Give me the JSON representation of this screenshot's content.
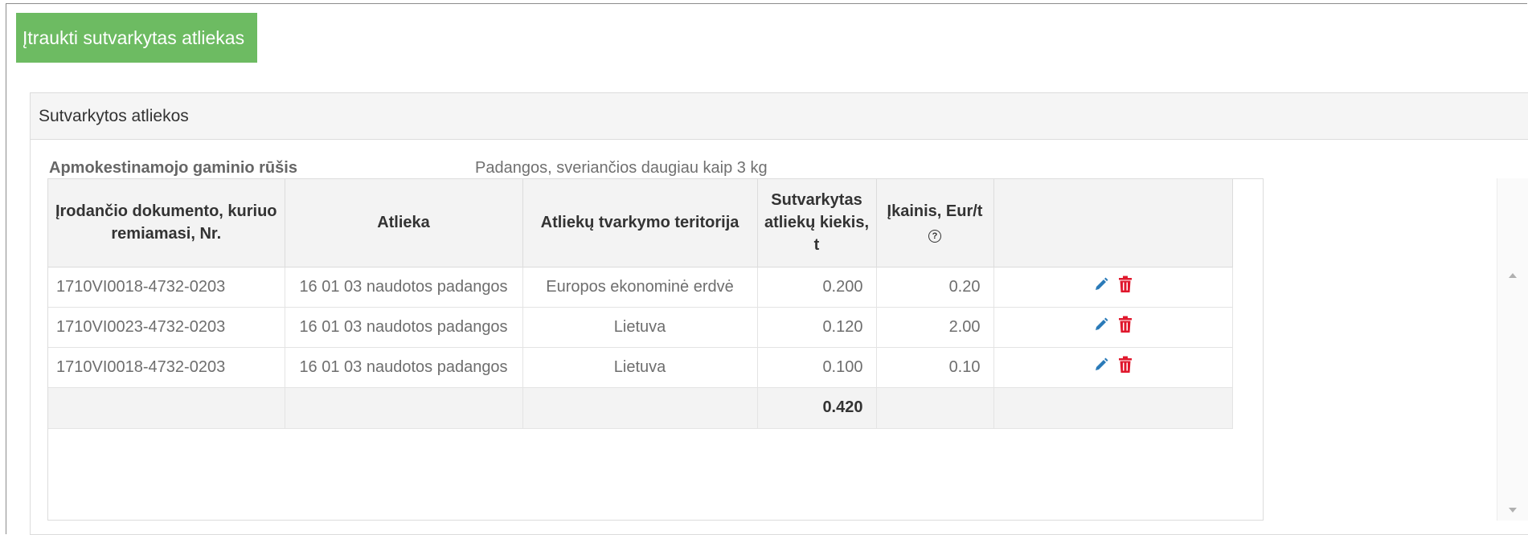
{
  "button": {
    "label": "Įtraukti sutvarkytas atliekas",
    "color": "#6dbb62"
  },
  "panel": {
    "title": "Sutvarkytos atliekos",
    "product_type_label": "Apmokestinamojo gaminio rūšis",
    "product_type_value": "Padangos, sveriančios daugiau kaip 3 kg"
  },
  "table": {
    "headers": {
      "doc_no": "Įrodančio dokumento, kuriuo remiamasi, Nr.",
      "waste": "Atlieka",
      "territory": "Atliekų tvarkymo teritorija",
      "quantity": "Sutvarkytas atliekų kiekis, t",
      "price": "Įkainis, Eur/t"
    },
    "rows": [
      {
        "doc_no": "1710VI0018-4732-0203",
        "waste": "16 01 03 naudotos padangos",
        "territory": "Europos ekonominė erdvė",
        "quantity": "0.200",
        "price": "0.20"
      },
      {
        "doc_no": "1710VI0023-4732-0203",
        "waste": "16 01 03 naudotos padangos",
        "territory": "Lietuva",
        "quantity": "0.120",
        "price": "2.00"
      },
      {
        "doc_no": "1710VI0018-4732-0203",
        "waste": "16 01 03 naudotos padangos",
        "territory": "Lietuva",
        "quantity": "0.100",
        "price": "0.10"
      }
    ],
    "total_quantity": "0.420",
    "icons": {
      "edit": "pencil-icon",
      "delete": "trash-icon",
      "help": "question-circle-icon"
    },
    "colors": {
      "edit": "#2a7ab8",
      "delete": "#e0182d"
    }
  }
}
